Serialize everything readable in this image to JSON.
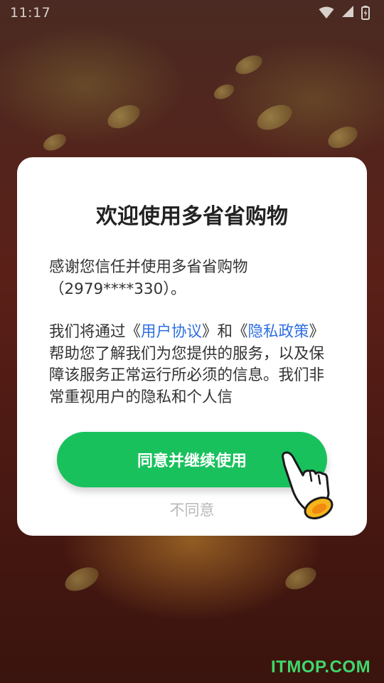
{
  "status_bar": {
    "time": "11:17",
    "icons": [
      "wifi-icon",
      "battery-icon"
    ]
  },
  "dialog": {
    "title": "欢迎使用多省省购物",
    "paragraph1_line1": "感谢您信任并使用多省省购物",
    "paragraph1_line2": "（2979****330）。",
    "paragraph2_pre": "我们将通过《",
    "user_agreement_link": "用户协议",
    "paragraph2_mid": "》和《",
    "privacy_policy_link": "隐私政策",
    "paragraph2_post": "》帮助您了解我们为您提供的服务，以及保障该服务正常运行所必须的信息。我们非常重视用户的隐私和个人信",
    "agree_button": "同意并继续使用",
    "disagree_button": "不同意"
  },
  "watermark": "ITMOP.COM",
  "colors": {
    "accent_green": "#19c15d",
    "link_blue": "#2f6fe0",
    "watermark_green": "#3fd86a"
  }
}
